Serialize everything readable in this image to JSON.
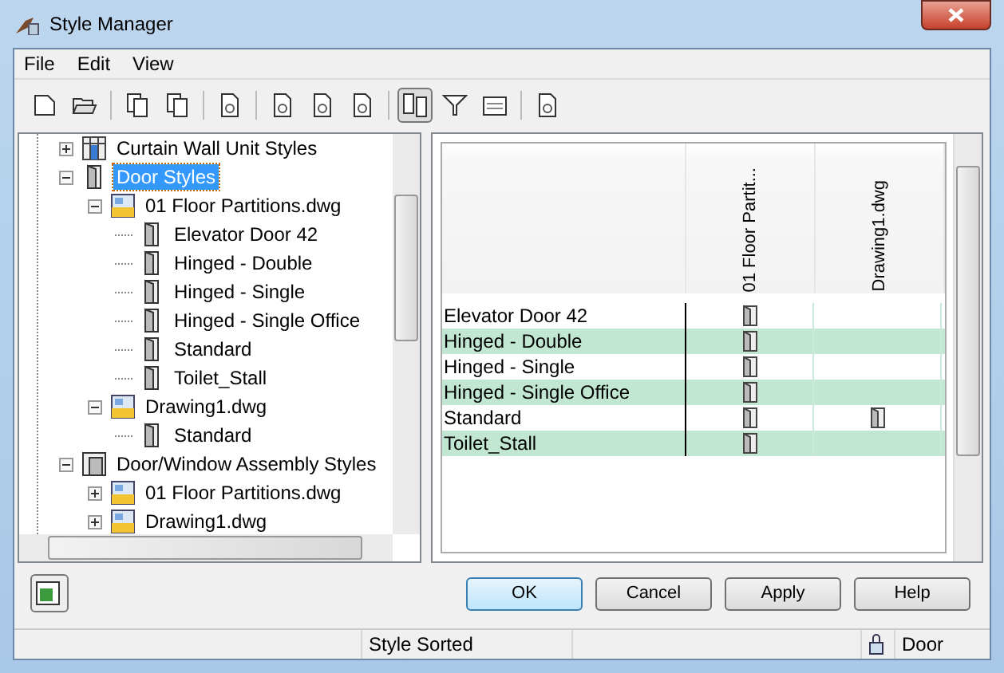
{
  "window": {
    "title": "Style Manager"
  },
  "menu": [
    "File",
    "Edit",
    "View"
  ],
  "toolbar": [
    {
      "kind": "new",
      "pressed": false
    },
    {
      "kind": "open",
      "pressed": false
    },
    {
      "kind": "sep"
    },
    {
      "kind": "copy",
      "pressed": false
    },
    {
      "kind": "paste",
      "pressed": false
    },
    {
      "kind": "sep"
    },
    {
      "kind": "purge",
      "pressed": false
    },
    {
      "kind": "sep"
    },
    {
      "kind": "newstyle",
      "pressed": false
    },
    {
      "kind": "edit",
      "pressed": false
    },
    {
      "kind": "clean",
      "pressed": false
    },
    {
      "kind": "sep"
    },
    {
      "kind": "toggle",
      "pressed": true
    },
    {
      "kind": "filter",
      "pressed": false
    },
    {
      "kind": "view",
      "pressed": false
    },
    {
      "kind": "sep"
    },
    {
      "kind": "props",
      "pressed": false
    }
  ],
  "tree": [
    {
      "label": "Curtain Wall Unit Styles",
      "kind": "curtain",
      "expanded": false,
      "selected": false
    },
    {
      "label": "Door Styles",
      "kind": "door",
      "expanded": true,
      "selected": true,
      "children": [
        {
          "label": "01 Floor Partitions.dwg",
          "kind": "drawing",
          "expanded": true,
          "selected": false,
          "children": [
            {
              "label": "Elevator Door 42",
              "kind": "door",
              "selected": false
            },
            {
              "label": "Hinged - Double",
              "kind": "door",
              "selected": false
            },
            {
              "label": "Hinged - Single",
              "kind": "door",
              "selected": false
            },
            {
              "label": "Hinged - Single Office",
              "kind": "door",
              "selected": false
            },
            {
              "label": "Standard",
              "kind": "door",
              "selected": false
            },
            {
              "label": "Toilet_Stall",
              "kind": "door",
              "selected": false
            }
          ]
        },
        {
          "label": "Drawing1.dwg",
          "kind": "drawing",
          "expanded": true,
          "selected": false,
          "children": [
            {
              "label": "Standard",
              "kind": "door",
              "selected": false
            }
          ]
        }
      ]
    },
    {
      "label": "Door/Window Assembly Styles",
      "kind": "assembly",
      "expanded": true,
      "selected": false,
      "children": [
        {
          "label": "01 Floor Partitions.dwg",
          "kind": "drawing",
          "expanded": false,
          "selected": false
        },
        {
          "label": "Drawing1.dwg",
          "kind": "drawing",
          "expanded": false,
          "selected": false
        }
      ]
    }
  ],
  "matrix": {
    "columns": [
      "01 Floor Partit...",
      "Drawing1.dwg"
    ],
    "rows": [
      {
        "name": "Elevator Door 42",
        "cells": [
          true,
          false
        ]
      },
      {
        "name": "Hinged - Double",
        "cells": [
          true,
          false
        ]
      },
      {
        "name": "Hinged - Single",
        "cells": [
          true,
          false
        ]
      },
      {
        "name": "Hinged - Single Office",
        "cells": [
          true,
          false
        ]
      },
      {
        "name": "Standard",
        "cells": [
          true,
          true
        ]
      },
      {
        "name": "Toilet_Stall",
        "cells": [
          true,
          false
        ]
      }
    ]
  },
  "buttons": [
    {
      "label": "OK",
      "default": true
    },
    {
      "label": "Cancel",
      "default": false
    },
    {
      "label": "Apply",
      "default": false
    },
    {
      "label": "Help",
      "default": false
    }
  ],
  "status_bar": [
    "Style Sorted",
    "Door"
  ]
}
